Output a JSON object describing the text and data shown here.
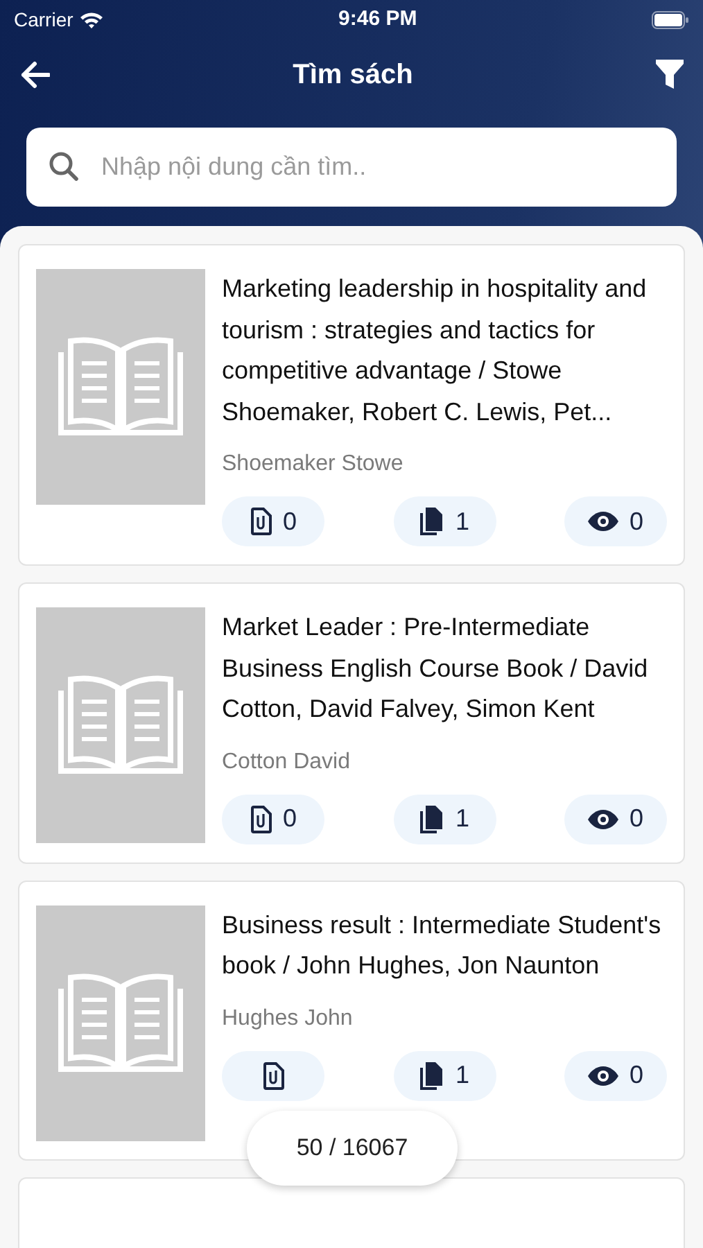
{
  "status_bar": {
    "carrier": "Carrier",
    "time": "9:46 PM"
  },
  "header": {
    "title": "Tìm sách"
  },
  "search": {
    "placeholder": "Nhập nội dung cần tìm.."
  },
  "books": [
    {
      "kind": "book",
      "title": "Marketing leadership in hospitality and tourism : strategies and tactics for competitive advantage / Stowe Shoemaker, Robert C. Lewis, Pet...",
      "author": "Shoemaker Stowe",
      "stats": [
        {
          "kind": "attachments",
          "count": "0"
        },
        {
          "kind": "files",
          "count": "1"
        },
        {
          "kind": "views",
          "count": "0"
        }
      ]
    },
    {
      "kind": "book",
      "title": "Market Leader : Pre-Intermediate Business English Course Book / David Cotton, David Falvey, Simon Kent",
      "author": "Cotton David",
      "stats": [
        {
          "kind": "attachments",
          "count": "0"
        },
        {
          "kind": "files",
          "count": "1"
        },
        {
          "kind": "views",
          "count": "0"
        }
      ]
    },
    {
      "kind": "book",
      "title": "Business result : Intermediate Student's book / John Hughes, Jon Naunton",
      "author": "Hughes John",
      "stats": [
        {
          "kind": "attachments"
        },
        {
          "kind": "files",
          "count": "1"
        },
        {
          "kind": "views",
          "count": "0"
        }
      ]
    },
    {
      "kind": "cut"
    }
  ],
  "counter": "50 / 16067"
}
